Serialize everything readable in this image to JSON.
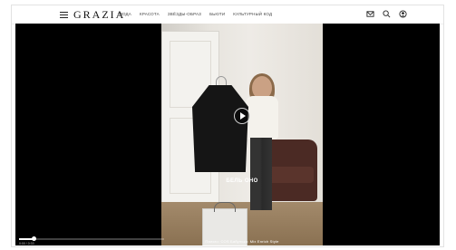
{
  "header": {
    "logo": "GRAZIA",
    "nav": [
      "мода",
      "красота",
      "звёзды-образ",
      "Бьюти",
      "Культурный код"
    ]
  },
  "video": {
    "caption": "БЕЛЬ ОНО",
    "subtitle": "Пальто: COS  Бабулька:  Mix Enrich Style",
    "time": "0:00 / 0:33",
    "progress": 0.1
  },
  "icons": [
    "menu-icon",
    "mail-icon",
    "search-icon",
    "account-icon",
    "play-icon"
  ]
}
